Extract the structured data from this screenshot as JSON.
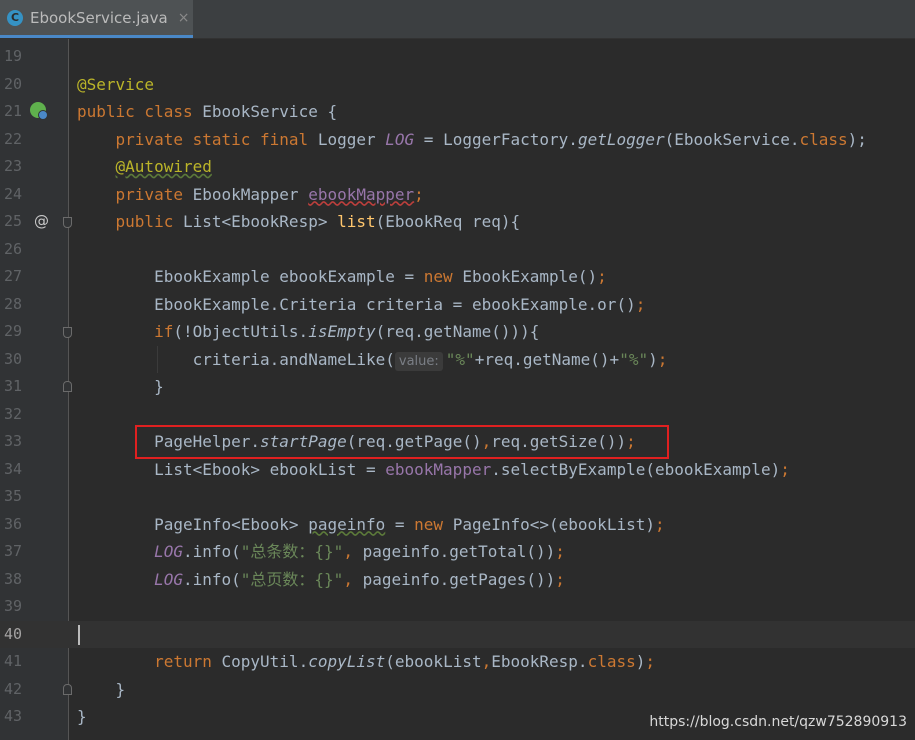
{
  "tab": {
    "filename": "EbookService.java",
    "icon": "class-icon",
    "icon_letter": "C",
    "close": "×"
  },
  "watermark": "https://blog.csdn.net/qzw752890913",
  "lines": [
    {
      "n": "19"
    },
    {
      "n": "20",
      "parts": [
        [
          "ann",
          "@Service"
        ]
      ]
    },
    {
      "n": "21",
      "parts": [
        [
          "kw",
          "public class "
        ],
        [
          "",
          "EbookService {"
        ]
      ]
    },
    {
      "n": "22",
      "parts": [
        [
          "",
          "    "
        ],
        [
          "kw",
          "private static final "
        ],
        [
          "",
          "Logger "
        ],
        [
          "sfield",
          "LOG"
        ],
        [
          "",
          " = LoggerFactory."
        ],
        [
          "smeth",
          "getLogger"
        ],
        [
          "",
          "(EbookService."
        ],
        [
          "kw",
          "class"
        ],
        [
          "",
          ");"
        ]
      ]
    },
    {
      "n": "23",
      "parts": [
        [
          "",
          "    "
        ],
        [
          "ann squig",
          "@Autowired"
        ]
      ]
    },
    {
      "n": "24",
      "parts": [
        [
          "",
          "    "
        ],
        [
          "kw",
          "private "
        ],
        [
          "",
          "EbookMapper "
        ],
        [
          "field squig-red",
          "ebookMapper"
        ],
        [
          "kw",
          ";"
        ]
      ]
    },
    {
      "n": "25",
      "parts": [
        [
          "",
          "    "
        ],
        [
          "kw",
          "public "
        ],
        [
          "",
          "List<EbookResp> "
        ],
        [
          "fn",
          "list"
        ],
        [
          "",
          "(EbookReq req){"
        ]
      ]
    },
    {
      "n": "26"
    },
    {
      "n": "27",
      "parts": [
        [
          "",
          "        EbookExample ebookExample = "
        ],
        [
          "kw",
          "new "
        ],
        [
          "",
          "EbookExample()"
        ],
        [
          "kw",
          ";"
        ]
      ]
    },
    {
      "n": "28",
      "parts": [
        [
          "",
          "        EbookExample.Criteria criteria = ebookExample.or()"
        ],
        [
          "kw",
          ";"
        ]
      ]
    },
    {
      "n": "29",
      "parts": [
        [
          "",
          "        "
        ],
        [
          "kw",
          "if"
        ],
        [
          "",
          "(!ObjectUtils."
        ],
        [
          "smeth",
          "isEmpty"
        ],
        [
          "",
          "(req.getName())){"
        ]
      ]
    },
    {
      "n": "30",
      "parts": [
        [
          "",
          "            criteria.andNameLike("
        ],
        [
          "hint",
          "value:"
        ],
        [
          "str",
          "\"%\""
        ],
        [
          "",
          "+req.getName()+"
        ],
        [
          "str",
          "\"%\""
        ],
        [
          "",
          ")"
        ],
        [
          "kw",
          ";"
        ]
      ]
    },
    {
      "n": "31",
      "parts": [
        [
          "",
          "        }"
        ]
      ]
    },
    {
      "n": "32"
    },
    {
      "n": "33",
      "parts": [
        [
          "",
          "        PageHelper."
        ],
        [
          "smeth",
          "startPage"
        ],
        [
          "",
          "(req.getPage()"
        ],
        [
          "kw",
          ","
        ],
        [
          "",
          "req.getSize())"
        ],
        [
          "kw",
          ";"
        ]
      ]
    },
    {
      "n": "34",
      "parts": [
        [
          "",
          "        List<Ebook> ebookList = "
        ],
        [
          "field",
          "ebookMapper"
        ],
        [
          "",
          ".selectByExample(ebookExample)"
        ],
        [
          "kw",
          ";"
        ]
      ]
    },
    {
      "n": "35"
    },
    {
      "n": "36",
      "parts": [
        [
          "",
          "        PageInfo<Ebook> "
        ],
        [
          "squig",
          "pageinfo"
        ],
        [
          "",
          " = "
        ],
        [
          "kw",
          "new "
        ],
        [
          "",
          "PageInfo<>(ebookList)"
        ],
        [
          "kw",
          ";"
        ]
      ]
    },
    {
      "n": "37",
      "parts": [
        [
          "",
          "        "
        ],
        [
          "sfield",
          "LOG"
        ],
        [
          "",
          ".info("
        ],
        [
          "str",
          "\"总条数：{}\""
        ],
        [
          "kw",
          ", "
        ],
        [
          "",
          "pageinfo.getTotal())"
        ],
        [
          "kw",
          ";"
        ]
      ]
    },
    {
      "n": "38",
      "parts": [
        [
          "",
          "        "
        ],
        [
          "sfield",
          "LOG"
        ],
        [
          "",
          ".info("
        ],
        [
          "str",
          "\"总页数：{}\""
        ],
        [
          "kw",
          ", "
        ],
        [
          "",
          "pageinfo.getPages())"
        ],
        [
          "kw",
          ";"
        ]
      ]
    },
    {
      "n": "39"
    },
    {
      "n": "40",
      "current": true
    },
    {
      "n": "41",
      "parts": [
        [
          "",
          "        "
        ],
        [
          "kw",
          "return "
        ],
        [
          "",
          "CopyUtil."
        ],
        [
          "smeth",
          "copyList"
        ],
        [
          "",
          "(ebookList"
        ],
        [
          "kw",
          ","
        ],
        [
          "",
          "EbookResp."
        ],
        [
          "kw",
          "class"
        ],
        [
          "",
          ")"
        ],
        [
          "kw",
          ";"
        ]
      ]
    },
    {
      "n": "42",
      "parts": [
        [
          "",
          "    }"
        ]
      ]
    },
    {
      "n": "43",
      "parts": [
        [
          "",
          "}"
        ]
      ]
    }
  ],
  "gutter_icons": {
    "21": "spring-bean-icon",
    "25": "override-icon",
    "25_fold": "open",
    "29_fold": "open",
    "31_fold": "close",
    "42_fold": "close"
  },
  "override_glyph": "@",
  "colors": {
    "background": "#2b2b2b",
    "keyword": "#cc7832",
    "annotation": "#bbb529",
    "string": "#6a8759",
    "field": "#9876aa",
    "highlight_box": "#e02020"
  }
}
